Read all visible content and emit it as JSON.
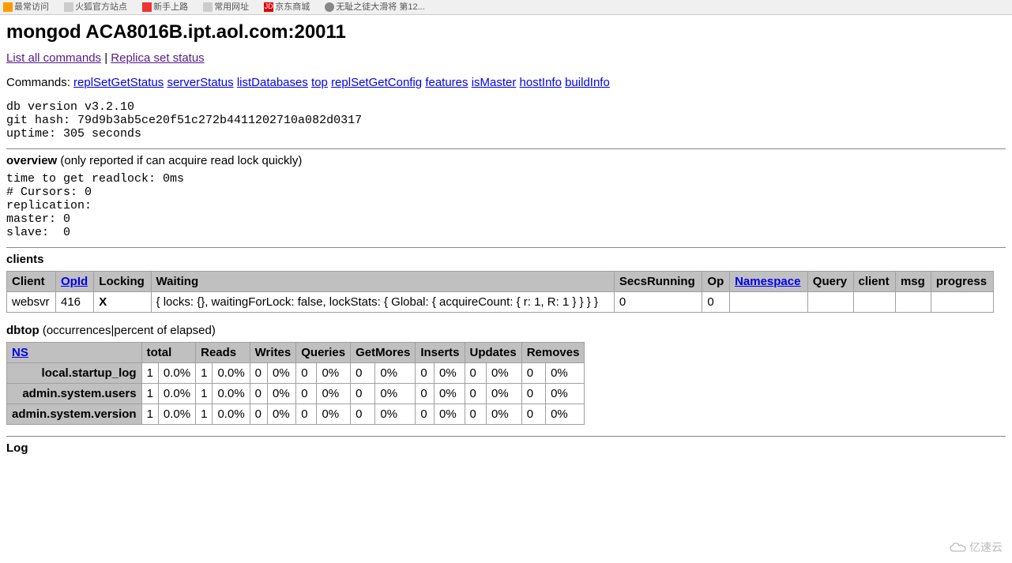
{
  "bookmarks": [
    "最常访问",
    "火狐官方站点",
    "新手上路",
    "常用网址",
    "京东商城",
    "无耻之徒大滑将 第12..."
  ],
  "title": "mongod ACA8016B.ipt.aol.com:20011",
  "toplinks": {
    "list_all": "List all commands",
    "replica": "Replica set status"
  },
  "commands_label": "Commands:",
  "commands": [
    "replSetGetStatus",
    "serverStatus",
    "listDatabases",
    "top",
    "replSetGetConfig",
    "features",
    "isMaster",
    "hostInfo",
    "buildInfo"
  ],
  "version_block": "db version v3.2.10\ngit hash: 79d9b3ab5ce20f51c272b4411202710a082d0317\nuptime: 305 seconds",
  "overview": {
    "label": "overview",
    "note": "(only reported if can acquire read lock quickly)",
    "block": "time to get readlock: 0ms\n# Cursors: 0\nreplication: \nmaster: 0\nslave:  0"
  },
  "clients": {
    "label": "clients",
    "headers": [
      "Client",
      "OpId",
      "Locking",
      "Waiting",
      "SecsRunning",
      "Op",
      "Namespace",
      "Query",
      "client",
      "msg",
      "progress"
    ],
    "link_headers": {
      "1": true,
      "6": true
    },
    "rows": [
      [
        "websvr",
        "416",
        "X",
        "{ locks: {}, waitingForLock: false, lockStats: { Global: { acquireCount: { r: 1, R: 1 } } } }",
        "0",
        "0",
        "",
        "",
        "",
        "",
        ""
      ]
    ]
  },
  "dbtop": {
    "label": "dbtop",
    "note": "(occurrences|percent of elapsed)",
    "headers": [
      "NS",
      "total",
      "",
      "Reads",
      "",
      "Writes",
      "",
      "Queries",
      "",
      "GetMores",
      "",
      "Inserts",
      "",
      "Updates",
      "",
      "Removes",
      ""
    ],
    "link_headers": {
      "0": true
    },
    "rows": [
      [
        "local.startup_log",
        "1",
        "0.0%",
        "1",
        "0.0%",
        "0",
        "0%",
        "0",
        "0%",
        "0",
        "0%",
        "0",
        "0%",
        "0",
        "0%",
        "0",
        "0%"
      ],
      [
        "admin.system.users",
        "1",
        "0.0%",
        "1",
        "0.0%",
        "0",
        "0%",
        "0",
        "0%",
        "0",
        "0%",
        "0",
        "0%",
        "0",
        "0%",
        "0",
        "0%"
      ],
      [
        "admin.system.version",
        "1",
        "0.0%",
        "1",
        "0.0%",
        "0",
        "0%",
        "0",
        "0%",
        "0",
        "0%",
        "0",
        "0%",
        "0",
        "0%",
        "0",
        "0%"
      ]
    ]
  },
  "log_label": "Log",
  "watermark": "亿速云"
}
